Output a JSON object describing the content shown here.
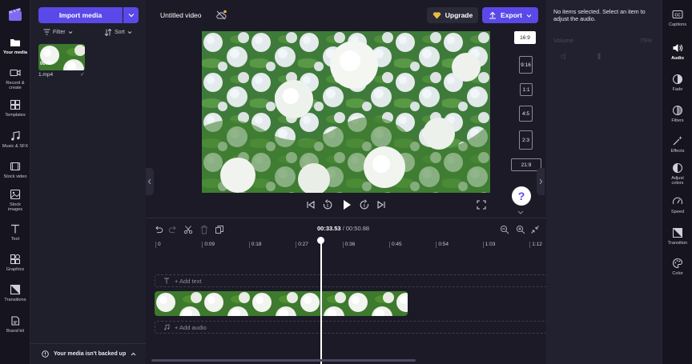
{
  "left_nav": {
    "items": [
      {
        "label": "Your media",
        "icon": "folder-icon",
        "active": true
      },
      {
        "label": "Record &\ncreate",
        "icon": "camera-icon",
        "active": false
      },
      {
        "label": "Templates",
        "icon": "templates-icon",
        "active": false
      },
      {
        "label": "Music & SFX",
        "icon": "music-icon",
        "active": false
      },
      {
        "label": "Stock video",
        "icon": "film-icon",
        "active": false
      },
      {
        "label": "Stock\nimages",
        "icon": "image-icon",
        "active": false
      },
      {
        "label": "Text",
        "icon": "text-icon",
        "active": false
      },
      {
        "label": "Graphics",
        "icon": "shapes-icon",
        "active": false
      },
      {
        "label": "Transitions",
        "icon": "transitions-icon",
        "active": false
      },
      {
        "label": "Brand kit",
        "icon": "brand-kit-icon",
        "active": false
      }
    ]
  },
  "media_panel": {
    "import_label": "Import media",
    "filter_label": "Filter",
    "sort_label": "Sort",
    "clip": {
      "duration": "00:50",
      "name": "1.mp4"
    },
    "backup_message": "Your media isn't backed up"
  },
  "topbar": {
    "title": "Untitled video",
    "upgrade_label": "Upgrade",
    "export_label": "Export"
  },
  "aspect_ratios": [
    "16:9",
    "9:16",
    "1:1",
    "4:5",
    "2:3",
    "21:9"
  ],
  "aspect_selected": "16:9",
  "help_label": "?",
  "timeline": {
    "current_time": "00:33.53",
    "separator": " / ",
    "total_time": "00:50.88",
    "playhead_progress": 0.659,
    "ruler": [
      "0",
      "0:09",
      "0:18",
      "0:27",
      "0:36",
      "0:45",
      "0:54",
      "1:03",
      "1:12"
    ],
    "add_text_label": "+ Add text",
    "add_audio_label": "+ Add audio"
  },
  "properties": {
    "message": "No items selected. Select an item to adjust the audio.",
    "volume_label": "Volume",
    "volume_value": "75%"
  },
  "right_nav": {
    "items": [
      {
        "label": "Captions",
        "icon": "captions-icon",
        "active": false
      },
      {
        "label": "Audio",
        "icon": "speaker-icon",
        "active": true
      },
      {
        "label": "Fade",
        "icon": "fade-icon",
        "active": false
      },
      {
        "label": "Filters",
        "icon": "filters-icon",
        "active": false
      },
      {
        "label": "Effects",
        "icon": "magic-wand-icon",
        "active": false
      },
      {
        "label": "Adjust\ncolors",
        "icon": "adjust-colors-icon",
        "active": false
      },
      {
        "label": "Speed",
        "icon": "speedometer-icon",
        "active": false
      },
      {
        "label": "Transition",
        "icon": "transition-icon",
        "active": false
      },
      {
        "label": "Color",
        "icon": "palette-icon",
        "active": false
      }
    ]
  },
  "colors": {
    "accent": "#5a49e8",
    "background": "#1b1a26",
    "panel": "#1f1e2b"
  }
}
